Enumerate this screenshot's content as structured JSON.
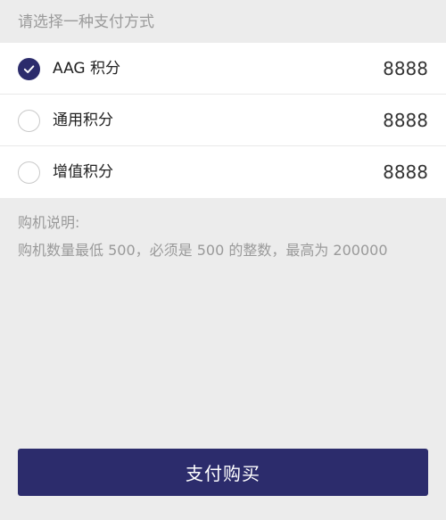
{
  "header": {
    "title": "请选择一种支付方式"
  },
  "options": [
    {
      "label": "AAG 积分",
      "value": "8888",
      "checked": true
    },
    {
      "label": "通用积分",
      "value": "8888",
      "checked": false
    },
    {
      "label": "增值积分",
      "value": "8888",
      "checked": false
    }
  ],
  "notes": {
    "title": "购机说明:",
    "text": "购机数量最低 500，必须是 500 的整数，最高为 200000"
  },
  "footer": {
    "pay_label": "支付购买"
  },
  "colors": {
    "accent": "#2c2c6c",
    "background": "#ececec",
    "muted_text": "#9a9a9a"
  }
}
